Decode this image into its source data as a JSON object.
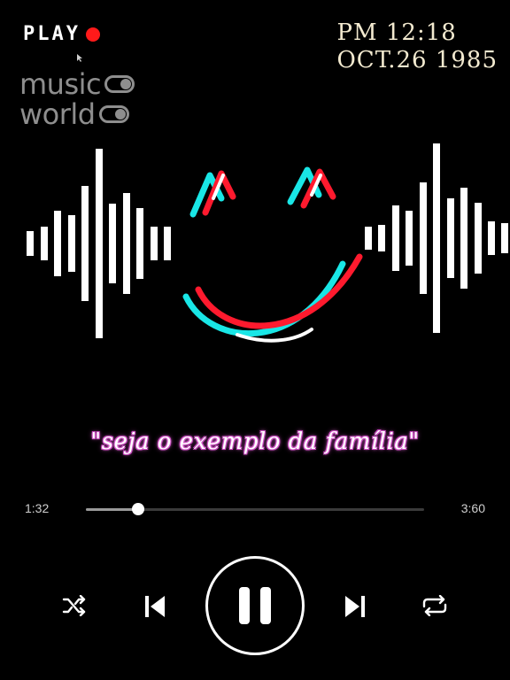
{
  "header": {
    "play_label": "PLAY",
    "clock_time": "PM 12:18",
    "clock_date": "OCT.26 1985"
  },
  "brand": {
    "line1": "music",
    "line2": "world"
  },
  "quote": "\"seja o exemplo da família\"",
  "player": {
    "elapsed": "1:32",
    "total": "3:60",
    "progress": 0.155
  },
  "colors": {
    "rec": "#ff1a1a",
    "glitch_cyan": "#19e6e6",
    "glitch_red": "#ff1a2e",
    "brand_gray": "#8e8e8e"
  },
  "icons": {
    "shuffle": "shuffle-icon",
    "previous": "skip-previous-icon",
    "pause": "pause-icon",
    "next": "skip-next-icon",
    "repeat": "repeat-icon"
  }
}
